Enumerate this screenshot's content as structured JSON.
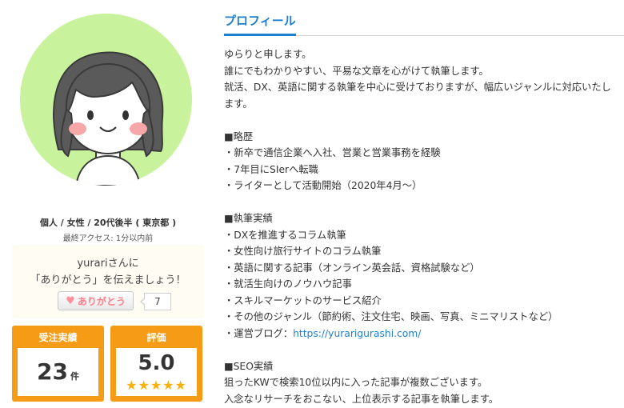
{
  "profile_card": {
    "meta_line": "個人 / 女性 / 20代後半 ( 東京都 )",
    "last_access": "最終アクセス: 1分以内前",
    "thanks": {
      "line1": "yurariさんに",
      "line2": "「ありがとう」を伝えましょう！",
      "button_label": "ありがとう",
      "count": "7"
    },
    "stats": {
      "orders_label": "受注実績",
      "orders_value": "23",
      "orders_unit": "件",
      "rating_label": "評価",
      "rating_value": "5.0",
      "rating_stars": 5,
      "stars_text": "★★★★★"
    },
    "colors": {
      "avatar_bg": "#c9f29c",
      "stat_bg": "#f59b15",
      "star": "#f6b10c"
    }
  },
  "profile": {
    "title": "プロフィール",
    "intro": [
      "ゆらりと申します。",
      "誰にでもわかりやすい、平易な文章を心がけて執筆します。",
      "就活、DX、英語に関する執筆を中心に受けておりますが、幅広いジャンルに対応いたし",
      "ます。"
    ],
    "career_heading": "■略歴",
    "career": [
      "・新卒で通信企業へ入社、営業と営業事務を経験",
      "・7年目にSIerへ転職",
      "・ライターとして活動開始（2020年4月～）"
    ],
    "works_heading": "■執筆実績",
    "works": [
      "・DXを推進するコラム執筆",
      "・女性向け旅行サイトのコラム執筆",
      "・英語に関する記事（オンライン英会話、資格試験など）",
      "・就活生向けのノウハウ記事",
      "・スキルマーケットのサービス紹介",
      "・その他のジャンル（節約術、注文住宅、映画、写真、ミニマリストなど）"
    ],
    "blog_prefix": "・運営ブログ：",
    "blog_url": "https://yurarigurashi.com/",
    "seo_heading": "■SEO実績",
    "seo": [
      "狙ったKWで検索10位以内に入った記事が複数ございます。",
      "入念なリサーチをおこない、上位表示する記事を執筆します。"
    ],
    "colors": {
      "accent": "#1f7fcf"
    }
  }
}
